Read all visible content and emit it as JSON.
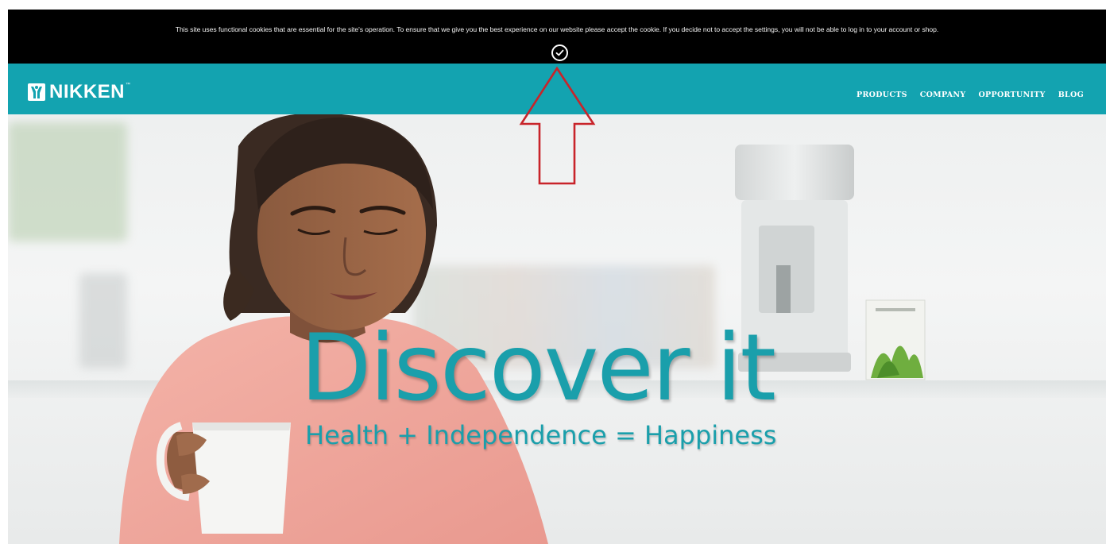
{
  "cookie_bar": {
    "message": "This site uses functional cookies that are essential for the site's operation. To ensure that we give you the best experience on our website please accept the cookie. If you decide not to accept the settings, you will not be able to log in to your account or shop.",
    "accept_icon": "check-circle-icon"
  },
  "header": {
    "logo_text": "NIKKEN",
    "logo_tm": "™",
    "nav": [
      "PRODUCTS",
      "COMPANY",
      "OPPORTUNITY",
      "BLOG"
    ]
  },
  "hero": {
    "headline": "Discover it",
    "tagline": "Health + Independence = Happiness"
  },
  "colors": {
    "brand_teal": "#13a3b0",
    "headline_teal": "#1a9fab",
    "cookie_bg": "#000000",
    "annotation_red": "#c8242a"
  }
}
